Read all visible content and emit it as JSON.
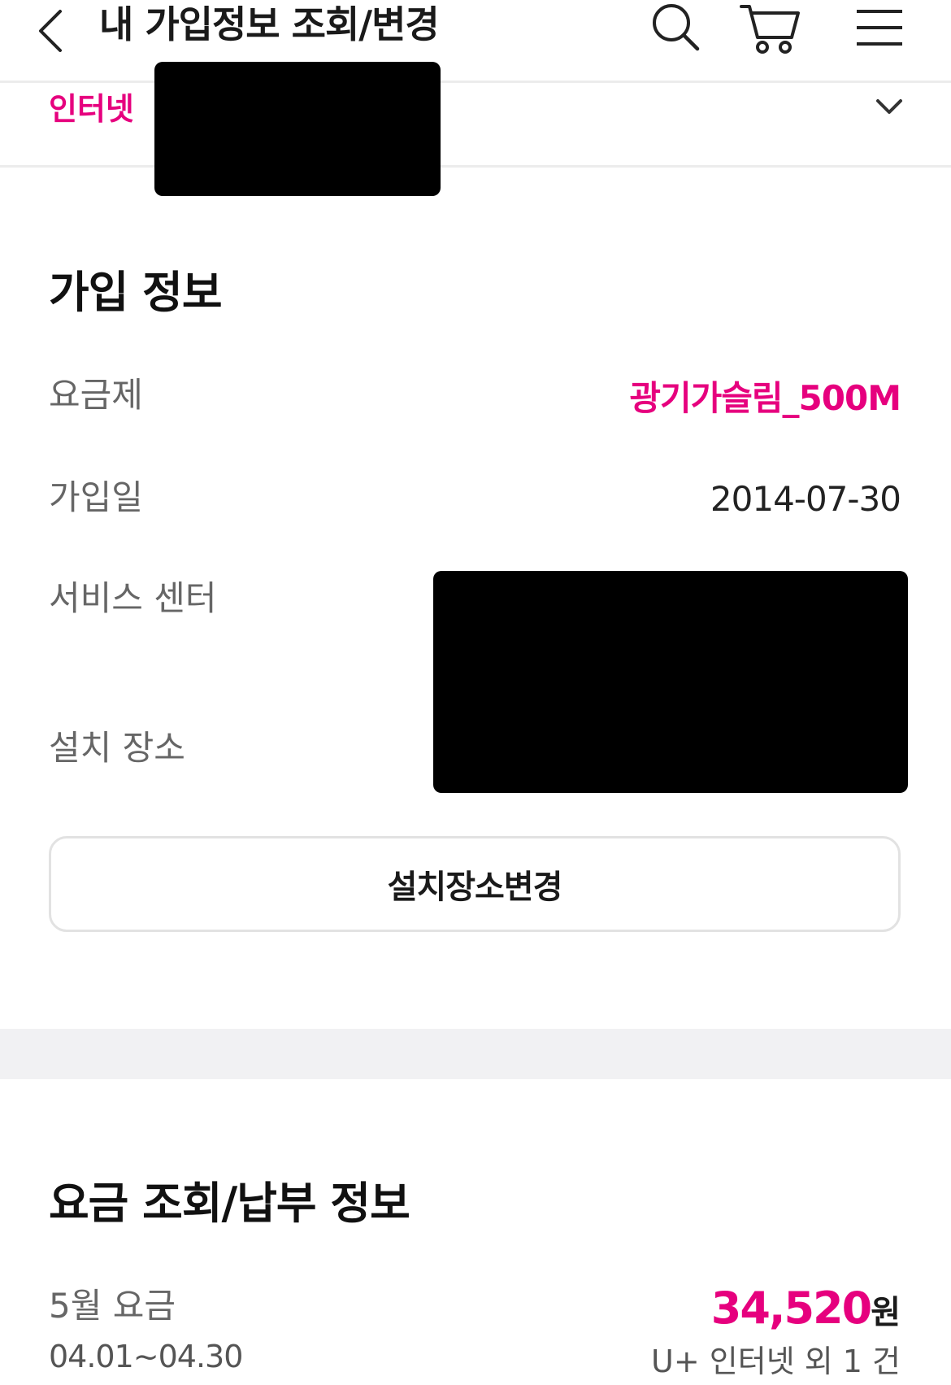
{
  "header": {
    "title": "내 가입정보 조회/변경"
  },
  "icons": {
    "back": "chevron-left-icon",
    "search": "search-icon",
    "cart": "cart-icon",
    "menu": "hamburger-menu-icon",
    "expand": "chevron-down-icon"
  },
  "product": {
    "type": "인터넷"
  },
  "subscription": {
    "title": "가입 정보",
    "plan_label": "요금제",
    "plan_value": "광기가슬림_500M",
    "join_date_label": "가입일",
    "join_date_value": "2014-07-30",
    "service_center_label": "서비스 센터",
    "install_place_label": "설치 장소",
    "change_button": "설치장소변경"
  },
  "billing": {
    "title": "요금 조회/납부 정보",
    "month_label": "5월 요금",
    "period": "04.01~04.30",
    "amount": "34,520",
    "currency": "원",
    "description": "U+ 인터넷 외 1 건"
  },
  "colors": {
    "accent": "#e6007e",
    "divider": "#ececec",
    "band": "#f1f1f3"
  }
}
